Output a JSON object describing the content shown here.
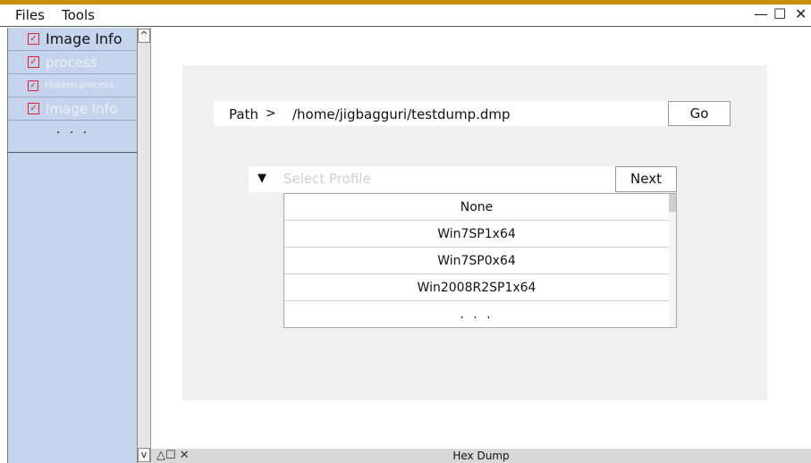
{
  "menubar": {
    "files_label": "Files",
    "tools_label": "Tools",
    "minimize_glyph": "—",
    "maximize_glyph": "☐",
    "close_glyph": "✕"
  },
  "sidebar": {
    "check_glyph": "✓",
    "items": [
      {
        "label": "Image Info"
      },
      {
        "label": "process"
      },
      {
        "label": "Hidden process"
      },
      {
        "label": "Image Info"
      }
    ],
    "more_label": ". . .",
    "scroll_up_glyph": "^",
    "scroll_down_glyph": "v"
  },
  "path": {
    "label": "Path",
    "separator": ">",
    "value": "/home/jigbagguri/testdump.dmp",
    "go_label": "Go"
  },
  "profile": {
    "arrow_glyph": "▼",
    "placeholder": "Select Profile",
    "next_label": "Next",
    "options": [
      "None",
      "Win7SP1x64",
      "Win7SP0x64",
      "Win2008R2SP1x64",
      ". . ."
    ]
  },
  "statusbar": {
    "icons": "△☐  ✕",
    "title": "Hex Dump"
  },
  "colors": {
    "accent": "#c8900a",
    "sidebar_bg": "#c5d4ec",
    "check_red": "#dd2233"
  }
}
